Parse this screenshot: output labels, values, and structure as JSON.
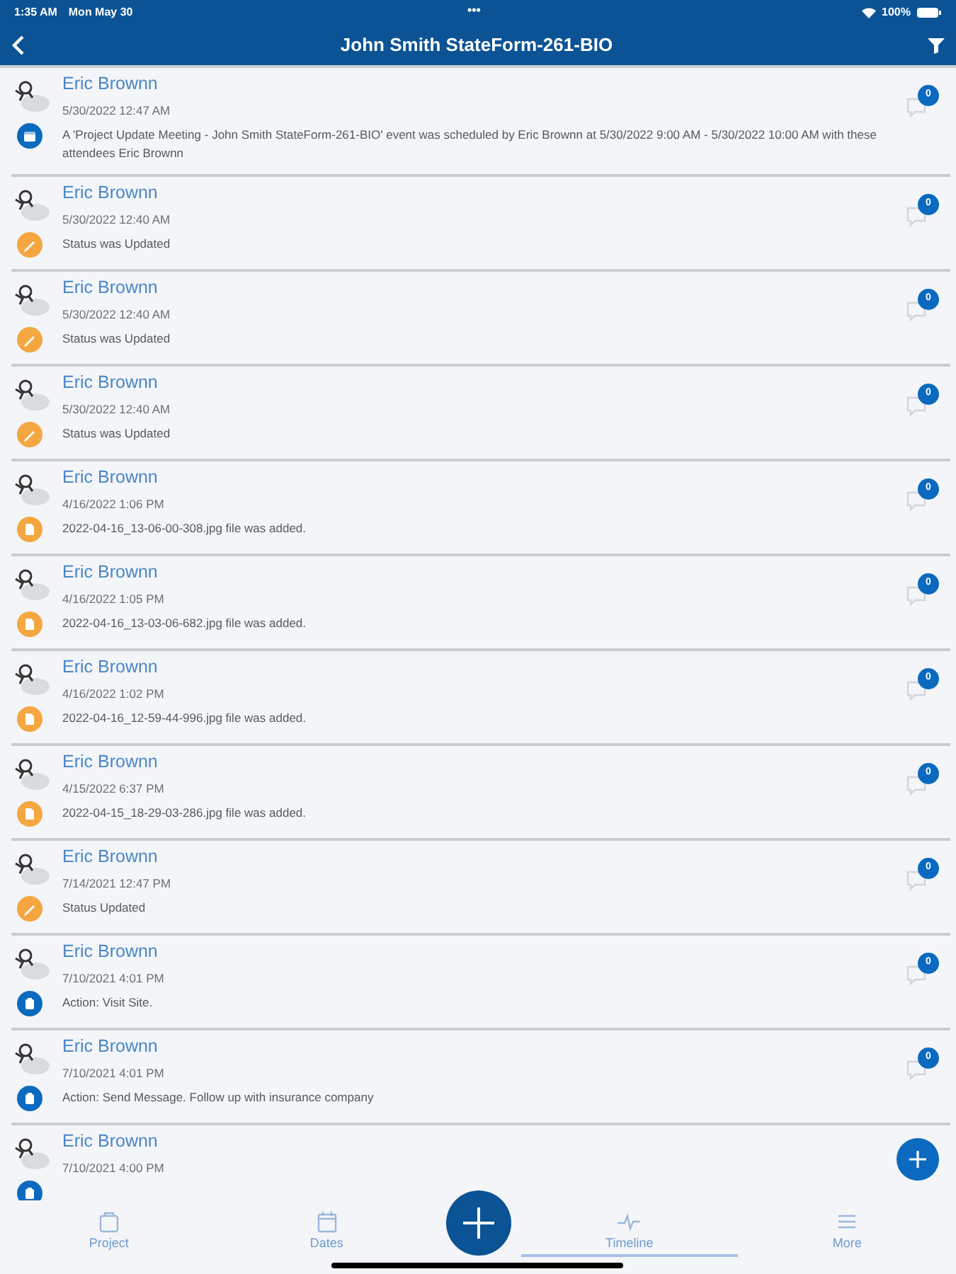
{
  "status_bar": {
    "time": "1:35 AM",
    "date": "Mon May 30",
    "dots": "•••",
    "battery": "100%"
  },
  "header": {
    "title": "John Smith StateForm-261-BIO"
  },
  "timeline": [
    {
      "author": "Eric Brownn",
      "timestamp": "5/30/2022 12:47 AM",
      "kind": "event",
      "description": "A 'Project Update Meeting - John Smith StateForm-261-BIO' event was scheduled by Eric Brownn at 5/30/2022 9:00 AM - 5/30/2022 10:00 AM with these attendees Eric Brownn",
      "comments": "0"
    },
    {
      "author": "Eric Brownn",
      "timestamp": "5/30/2022 12:40 AM",
      "kind": "status",
      "description": "Status was Updated",
      "comments": "0"
    },
    {
      "author": "Eric Brownn",
      "timestamp": "5/30/2022 12:40 AM",
      "kind": "status",
      "description": "Status was Updated",
      "comments": "0"
    },
    {
      "author": "Eric Brownn",
      "timestamp": "5/30/2022 12:40 AM",
      "kind": "status",
      "description": "Status was Updated",
      "comments": "0"
    },
    {
      "author": "Eric Brownn",
      "timestamp": "4/16/2022 1:06 PM",
      "kind": "file",
      "description": "2022-04-16_13-06-00-308.jpg file was added.",
      "comments": "0"
    },
    {
      "author": "Eric Brownn",
      "timestamp": "4/16/2022 1:05 PM",
      "kind": "file",
      "description": "2022-04-16_13-03-06-682.jpg file was added.",
      "comments": "0"
    },
    {
      "author": "Eric Brownn",
      "timestamp": "4/16/2022 1:02 PM",
      "kind": "file",
      "description": "2022-04-16_12-59-44-996.jpg file was added.",
      "comments": "0"
    },
    {
      "author": "Eric Brownn",
      "timestamp": "4/15/2022 6:37 PM",
      "kind": "file",
      "description": "2022-04-15_18-29-03-286.jpg file was added.",
      "comments": "0"
    },
    {
      "author": "Eric Brownn",
      "timestamp": "7/14/2021 12:47 PM",
      "kind": "status",
      "description": "Status Updated",
      "comments": "0"
    },
    {
      "author": "Eric Brownn",
      "timestamp": "7/10/2021 4:01 PM",
      "kind": "action",
      "description": "Action: Visit Site.",
      "comments": "0"
    },
    {
      "author": "Eric Brownn",
      "timestamp": "7/10/2021 4:01 PM",
      "kind": "action",
      "description": "Action: Send Message. Follow up with insurance company",
      "comments": "0"
    },
    {
      "author": "Eric Brownn",
      "timestamp": "7/10/2021 4:00 PM",
      "kind": "action"
    }
  ],
  "tabs": [
    {
      "label": "Project",
      "selected": false
    },
    {
      "label": "Dates",
      "selected": false
    },
    {
      "label": "Timeline",
      "selected": true
    },
    {
      "label": "More",
      "selected": false
    }
  ]
}
